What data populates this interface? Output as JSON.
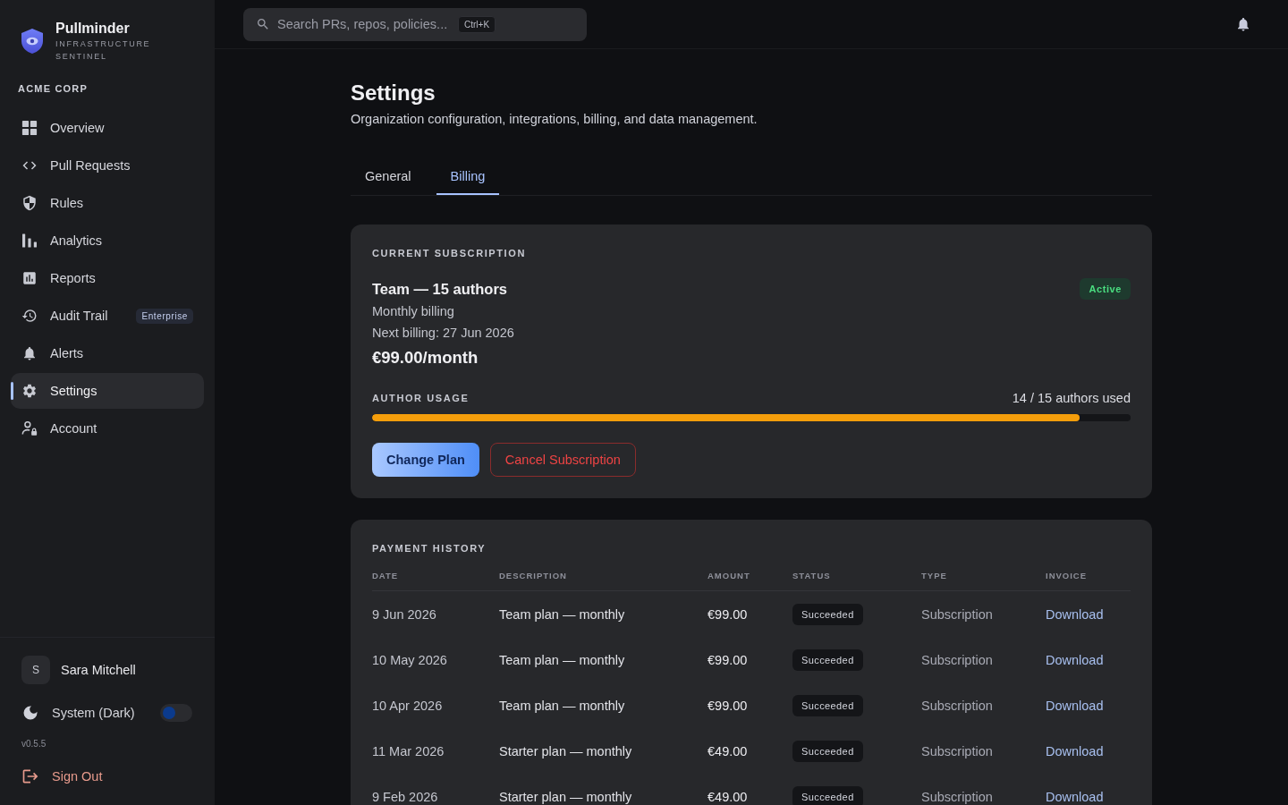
{
  "brand": {
    "name": "Pullminder",
    "tagline": "INFRASTRUCTURE SENTINEL"
  },
  "org": "ACME CORP",
  "nav": [
    {
      "label": "Overview",
      "selected": false
    },
    {
      "label": "Pull Requests",
      "selected": false
    },
    {
      "label": "Rules",
      "selected": false
    },
    {
      "label": "Analytics",
      "selected": false
    },
    {
      "label": "Reports",
      "selected": false
    },
    {
      "label": "Audit Trail",
      "selected": false,
      "badge": "Enterprise"
    },
    {
      "label": "Alerts",
      "selected": false
    },
    {
      "label": "Settings",
      "selected": true
    },
    {
      "label": "Account",
      "selected": false
    }
  ],
  "user": {
    "initial": "S",
    "name": "Sara Mitchell"
  },
  "theme": {
    "label": "System (Dark)",
    "on": false
  },
  "version": "v0.5.5",
  "sign_out": "Sign Out",
  "search": {
    "placeholder": "Search PRs, repos, policies...",
    "shortcut": "Ctrl+K"
  },
  "page": {
    "title": "Settings",
    "subtitle": "Organization configuration, integrations, billing, and data management."
  },
  "tabs": [
    {
      "label": "General",
      "selected": false
    },
    {
      "label": "Billing",
      "selected": true
    }
  ],
  "subscription": {
    "heading": "CURRENT SUBSCRIPTION",
    "plan": "Team — 15 authors",
    "status": "Active",
    "cycle": "Monthly billing",
    "next_billing": "Next billing: 27 Jun 2026",
    "price": "€99.00/month",
    "usage_label": "AUTHOR USAGE",
    "usage_reading": "14 / 15 authors used",
    "level": 0.933,
    "actions": [
      {
        "label": "Change Plan",
        "kind": "primary"
      },
      {
        "label": "Cancel Subscription",
        "kind": "danger"
      }
    ]
  },
  "payment_history": {
    "heading": "PAYMENT HISTORY",
    "columns": [
      "DATE",
      "DESCRIPTION",
      "AMOUNT",
      "STATUS",
      "TYPE",
      "INVOICE"
    ],
    "rows": [
      {
        "date": "9 Jun 2026",
        "description": "Team plan — monthly",
        "amount": "€99.00",
        "status": "Succeeded",
        "type": "Subscription",
        "invoice": "Download"
      },
      {
        "date": "10 May 2026",
        "description": "Team plan — monthly",
        "amount": "€99.00",
        "status": "Succeeded",
        "type": "Subscription",
        "invoice": "Download"
      },
      {
        "date": "10 Apr 2026",
        "description": "Team plan — monthly",
        "amount": "€99.00",
        "status": "Succeeded",
        "type": "Subscription",
        "invoice": "Download"
      },
      {
        "date": "11 Mar 2026",
        "description": "Starter plan — monthly",
        "amount": "€49.00",
        "status": "Succeeded",
        "type": "Subscription",
        "invoice": "Download"
      },
      {
        "date": "9 Feb 2026",
        "description": "Starter plan — monthly",
        "amount": "€49.00",
        "status": "Succeeded",
        "type": "Subscription",
        "invoice": "Download"
      }
    ]
  }
}
